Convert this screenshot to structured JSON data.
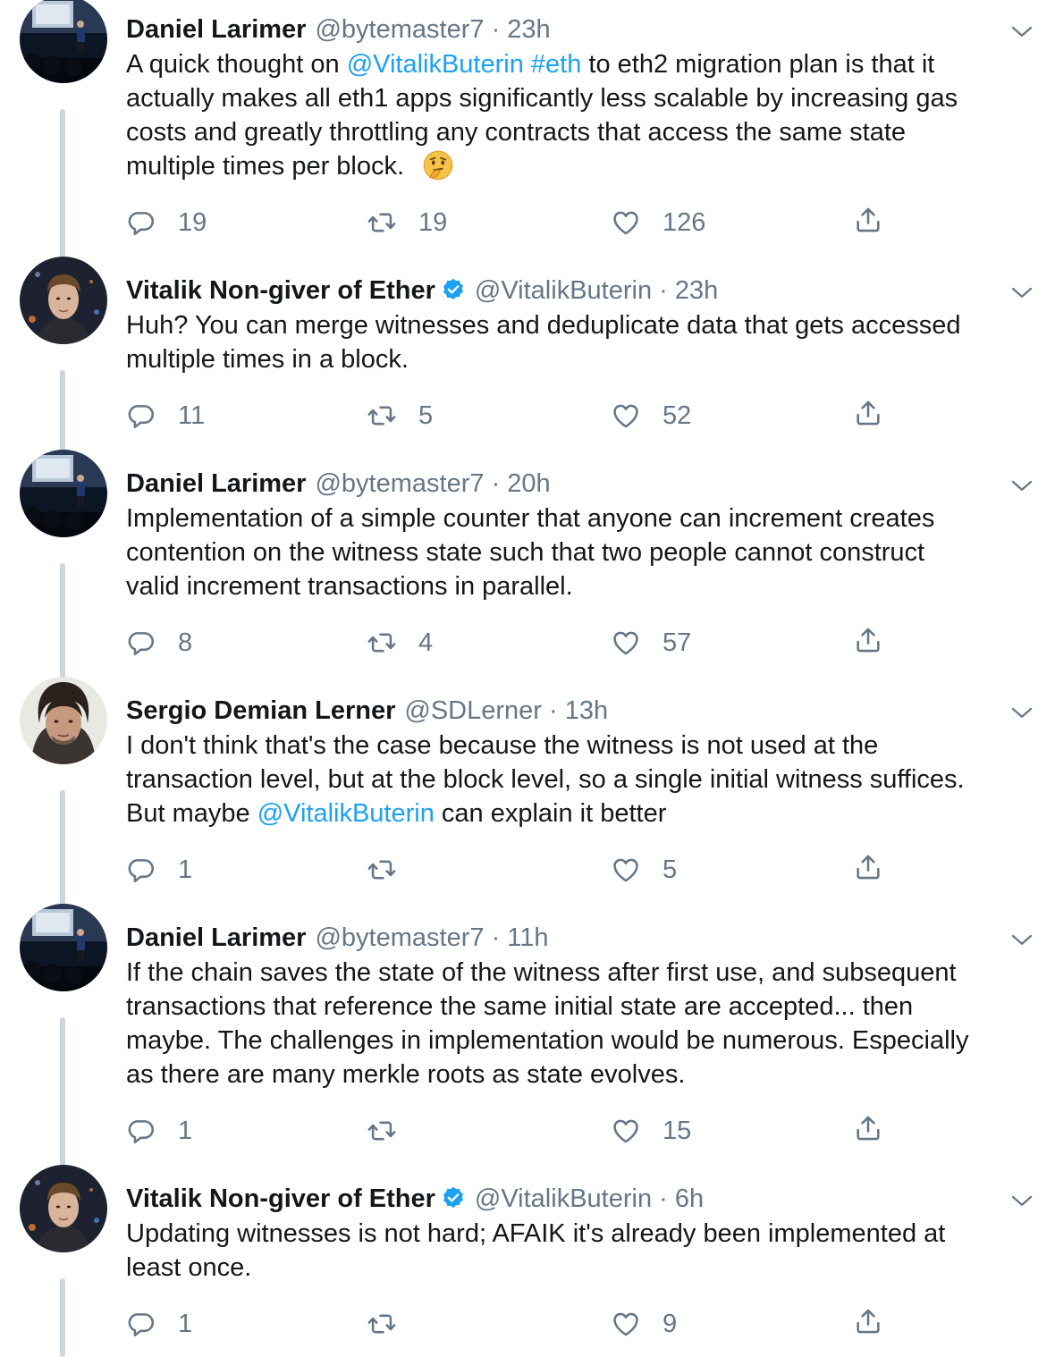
{
  "colors": {
    "text": "#14171a",
    "secondary": "#657786",
    "link": "#1da1f2",
    "thread_line": "#ccd6dd"
  },
  "icons": {
    "reply": "reply-icon",
    "retweet": "retweet-icon",
    "like": "heart-icon",
    "share": "share-icon",
    "menu": "chevron-down-icon",
    "verified": "verified-badge-icon"
  },
  "tweets": [
    {
      "name": "Daniel Larimer",
      "verified": false,
      "handle": "@bytemaster7",
      "dot": "·",
      "time": "23h",
      "text_parts": [
        {
          "t": "A quick thought on "
        },
        {
          "t": "@VitalikButerin",
          "link": true
        },
        {
          "t": " "
        },
        {
          "t": "#eth",
          "link": true
        },
        {
          "t": " to eth2 migration plan is that it\nactually makes all eth1 apps significantly less scalable by increasing gas\ncosts and greatly throttling any contracts that access the same state\nmultiple times per block."
        }
      ],
      "emoji": "thinking-face",
      "replies": "19",
      "retweets": "19",
      "likes": "126"
    },
    {
      "name": "Vitalik Non-giver of Ether",
      "verified": true,
      "handle": "@VitalikButerin",
      "dot": "·",
      "time": "23h",
      "text_parts": [
        {
          "t": "Huh? You can merge witnesses and deduplicate data that gets accessed\nmultiple times in a block."
        }
      ],
      "replies": "11",
      "retweets": "5",
      "likes": "52"
    },
    {
      "name": "Daniel Larimer",
      "verified": false,
      "handle": "@bytemaster7",
      "dot": "·",
      "time": "20h",
      "text_parts": [
        {
          "t": "Implementation of a simple counter that anyone can increment creates\ncontention on the witness state such that two people cannot construct\nvalid increment transactions in parallel."
        }
      ],
      "replies": "8",
      "retweets": "4",
      "likes": "57"
    },
    {
      "name": "Sergio Demian Lerner",
      "verified": false,
      "handle": "@SDLerner",
      "dot": "·",
      "time": "13h",
      "text_parts": [
        {
          "t": "I don't think that's the case because the witness is not used at the\ntransaction level, but at the block level, so a single initial witness suffices.\nBut maybe "
        },
        {
          "t": "@VitalikButerin",
          "link": true
        },
        {
          "t": " can explain it better"
        }
      ],
      "replies": "1",
      "retweets": "",
      "likes": "5"
    },
    {
      "name": "Daniel Larimer",
      "verified": false,
      "handle": "@bytemaster7",
      "dot": "·",
      "time": "11h",
      "text_parts": [
        {
          "t": "If the chain saves the state of the witness after first use, and subsequent\ntransactions that reference the same initial state are accepted... then\nmaybe.  The challenges in implementation would be numerous.  Especially\nas there are many merkle roots as state evolves."
        }
      ],
      "replies": "1",
      "retweets": "",
      "likes": "15"
    },
    {
      "name": "Vitalik Non-giver of Ether",
      "verified": true,
      "handle": "@VitalikButerin",
      "dot": "·",
      "time": "6h",
      "text_parts": [
        {
          "t": "Updating witnesses is not hard; AFAIK it's already been implemented at\nleast once."
        }
      ],
      "replies": "1",
      "retweets": "",
      "likes": "9"
    }
  ]
}
